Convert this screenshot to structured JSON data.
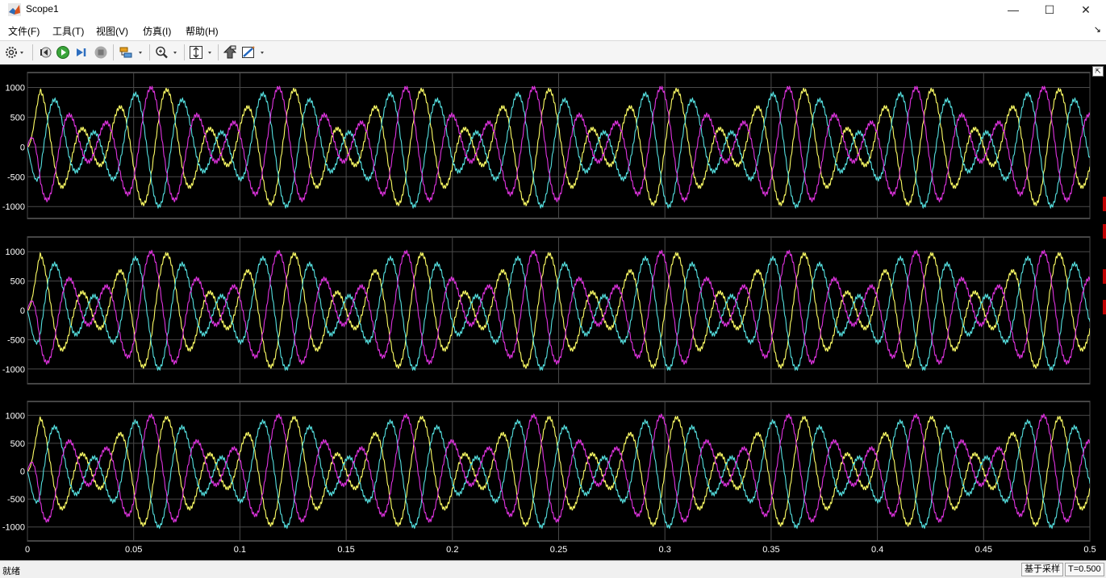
{
  "window": {
    "title": "Scope1",
    "minimize_glyph": "—",
    "maximize_glyph": "☐",
    "close_glyph": "✕"
  },
  "menu": [
    "文件(F)",
    "工具(T)",
    "视图(V)",
    "仿真(I)",
    "帮助(H)"
  ],
  "toolbar": {
    "icons": [
      "settings-icon",
      "step-back-icon",
      "run-icon",
      "step-forward-icon",
      "stop-icon",
      "signal-tools-icon",
      "zoom-icon",
      "axes-scale-icon",
      "highlight-block-icon",
      "style-icon"
    ]
  },
  "status": {
    "left": "就绪",
    "sampling": "基于采样",
    "time": "T=0.500"
  },
  "colors": {
    "phase_a": "#ffff66",
    "phase_b": "#55e0e0",
    "phase_c": "#e033e0",
    "grid": "#4a4a4a",
    "tick": "#ffffff"
  },
  "chart_data": [
    {
      "type": "line",
      "title": "",
      "xlabel": "",
      "ylabel": "",
      "xlim": [
        0,
        0.5
      ],
      "ylim": [
        -1200,
        1250
      ],
      "yticks": [
        -1000,
        -500,
        0,
        500,
        1000
      ],
      "xticks": [
        0,
        0.05,
        0.1,
        0.15,
        0.2,
        0.25,
        0.3,
        0.35,
        0.4,
        0.45,
        0.5
      ],
      "grid": true,
      "legend": "none",
      "series": [
        {
          "color": "#ffff66",
          "fundamental_hz": 50,
          "amplitude_peak": 1000,
          "phase_deg": 0,
          "envelope_period_s": 0.06
        },
        {
          "color": "#55e0e0",
          "fundamental_hz": 50,
          "amplitude_peak": 1000,
          "phase_deg": -120,
          "envelope_period_s": 0.06
        },
        {
          "color": "#e033e0",
          "fundamental_hz": 50,
          "amplitude_peak": 1000,
          "phase_deg": 120,
          "envelope_period_s": 0.06
        }
      ]
    },
    {
      "type": "line",
      "title": "",
      "xlabel": "",
      "ylabel": "",
      "xlim": [
        0,
        0.5
      ],
      "ylim": [
        -1250,
        1250
      ],
      "yticks": [
        -1000,
        -500,
        0,
        500,
        1000
      ],
      "xticks": [
        0,
        0.05,
        0.1,
        0.15,
        0.2,
        0.25,
        0.3,
        0.35,
        0.4,
        0.45,
        0.5
      ],
      "grid": true,
      "legend": "none",
      "series": [
        {
          "color": "#ffff66",
          "fundamental_hz": 50,
          "amplitude_peak": 1000,
          "phase_deg": 0,
          "envelope_period_s": 0.06
        },
        {
          "color": "#55e0e0",
          "fundamental_hz": 50,
          "amplitude_peak": 1000,
          "phase_deg": -120,
          "envelope_period_s": 0.06
        },
        {
          "color": "#e033e0",
          "fundamental_hz": 50,
          "amplitude_peak": 1000,
          "phase_deg": 120,
          "envelope_period_s": 0.06
        }
      ]
    },
    {
      "type": "line",
      "title": "",
      "xlabel": "",
      "ylabel": "",
      "xlim": [
        0,
        0.5
      ],
      "ylim": [
        -1250,
        1250
      ],
      "yticks": [
        -1000,
        -500,
        0,
        500,
        1000
      ],
      "xticks": [
        0,
        0.05,
        0.1,
        0.15,
        0.2,
        0.25,
        0.3,
        0.35,
        0.4,
        0.45,
        0.5
      ],
      "xticklabels": [
        "0",
        "0.05",
        "0.1",
        "0.15",
        "0.2",
        "0.25",
        "0.3",
        "0.35",
        "0.4",
        "0.45",
        "0.5"
      ],
      "grid": true,
      "legend": "none",
      "series": [
        {
          "color": "#ffff66",
          "fundamental_hz": 50,
          "amplitude_peak": 1000,
          "phase_deg": 0,
          "envelope_period_s": 0.06
        },
        {
          "color": "#55e0e0",
          "fundamental_hz": 50,
          "amplitude_peak": 1000,
          "phase_deg": -120,
          "envelope_period_s": 0.06
        },
        {
          "color": "#e033e0",
          "fundamental_hz": 50,
          "amplitude_peak": 1000,
          "phase_deg": 120,
          "envelope_period_s": 0.06
        }
      ]
    }
  ]
}
